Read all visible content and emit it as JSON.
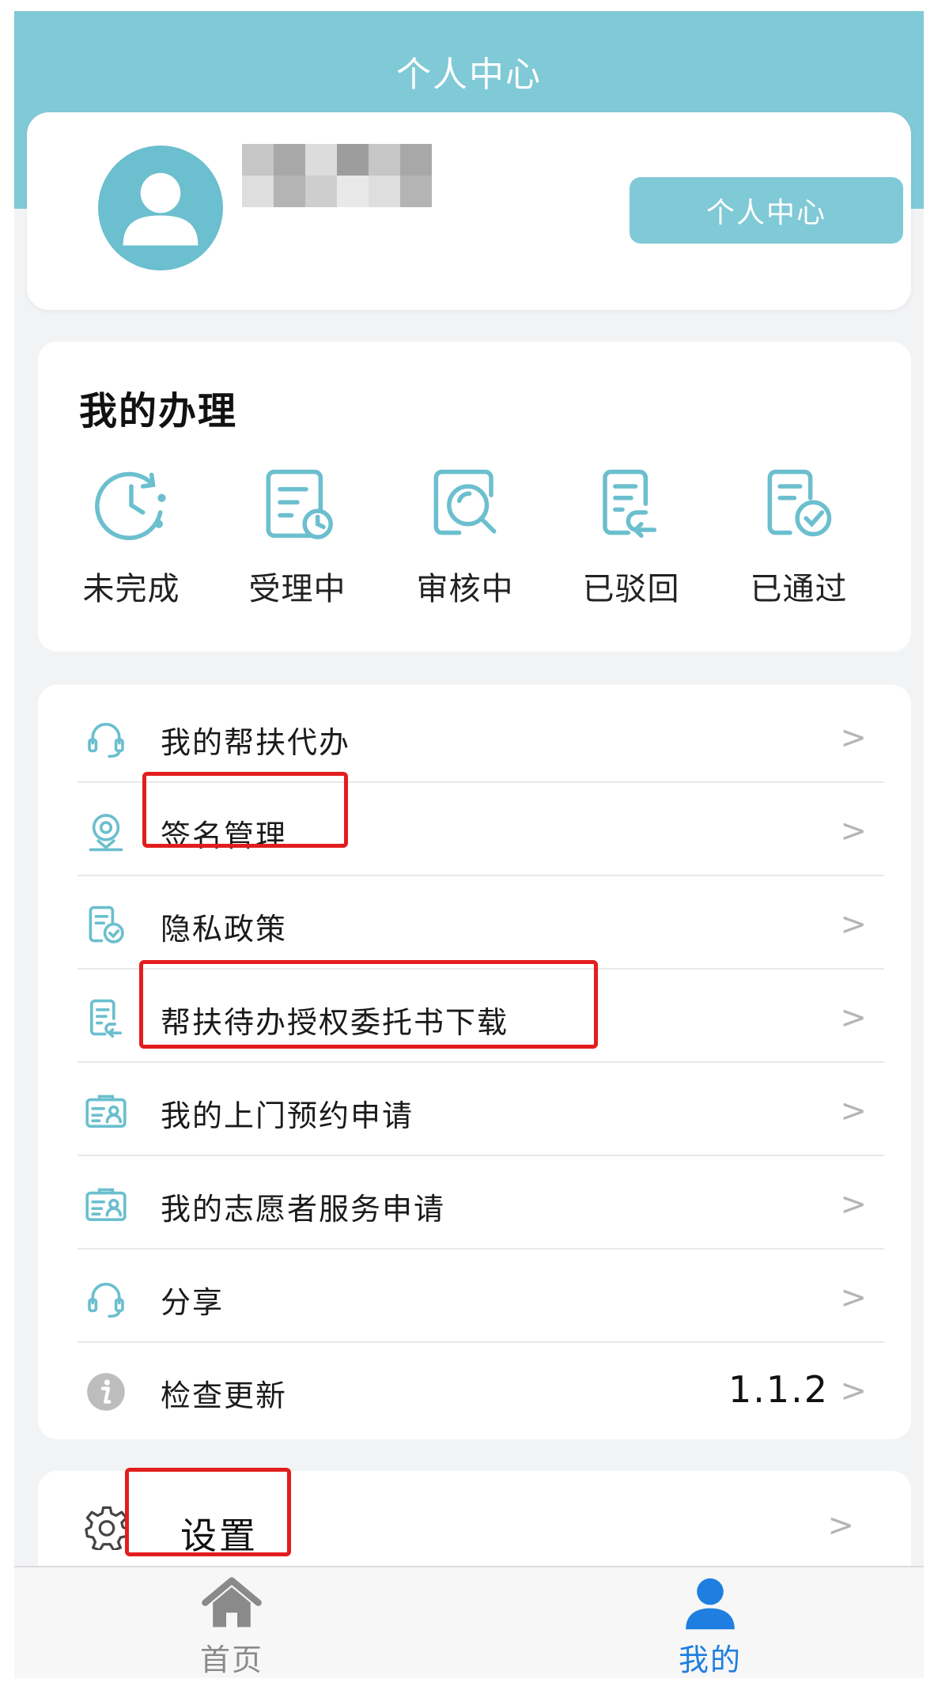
{
  "header": {
    "title": "个人中心"
  },
  "profile": {
    "center_button_label": "个人中心"
  },
  "my_handling": {
    "title": "我的办理",
    "statuses": [
      {
        "label": "未完成",
        "icon": "clock-icon"
      },
      {
        "label": "受理中",
        "icon": "document-clock-icon"
      },
      {
        "label": "审核中",
        "icon": "search-document-icon"
      },
      {
        "label": "已驳回",
        "icon": "document-return-icon"
      },
      {
        "label": "已通过",
        "icon": "document-check-icon"
      }
    ]
  },
  "menu": {
    "items": [
      {
        "label": "我的帮扶代办",
        "icon": "headset-icon"
      },
      {
        "label": "签名管理",
        "icon": "location-pin-icon"
      },
      {
        "label": "隐私政策",
        "icon": "document-check-icon"
      },
      {
        "label": "帮扶待办授权委托书下载",
        "icon": "document-return-icon"
      },
      {
        "label": "我的上门预约申请",
        "icon": "id-card-icon"
      },
      {
        "label": "我的志愿者服务申请",
        "icon": "id-card-icon"
      },
      {
        "label": "分享",
        "icon": "headset-icon"
      },
      {
        "label": "检查更新",
        "icon": "info-icon",
        "value": "1.1.2"
      }
    ],
    "chevron": ">"
  },
  "settings": {
    "label": "设置",
    "icon": "gear-icon"
  },
  "bottom_nav": {
    "tabs": [
      {
        "label": "首页",
        "icon": "home-icon",
        "active": false
      },
      {
        "label": "我的",
        "icon": "user-icon",
        "active": true
      }
    ]
  },
  "colors": {
    "accent": "#80c9d6",
    "active_tab": "#1f7fe0",
    "inactive_tab": "#8a8a8a",
    "highlight": "#e31d1d"
  }
}
